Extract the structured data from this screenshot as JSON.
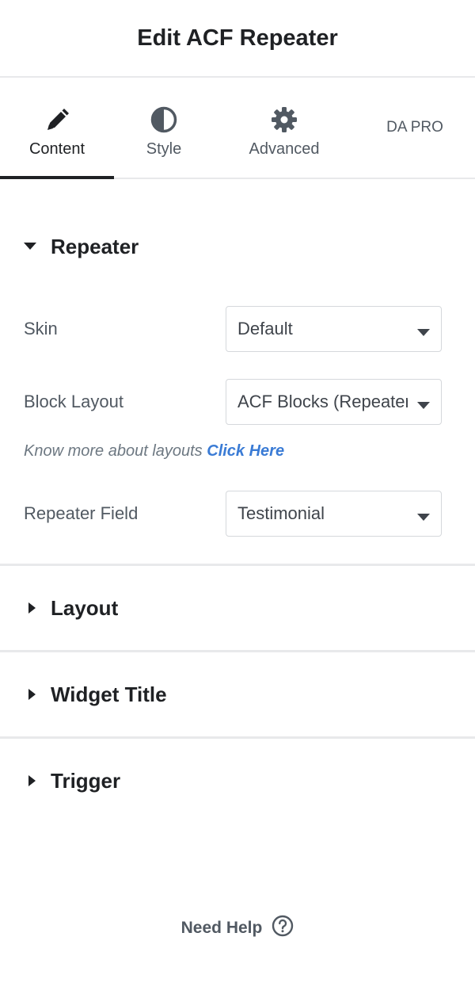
{
  "header": {
    "title": "Edit ACF Repeater"
  },
  "tabs": [
    {
      "label": "Content",
      "icon": "pencil-icon",
      "active": true
    },
    {
      "label": "Style",
      "icon": "contrast-icon",
      "active": false
    },
    {
      "label": "Advanced",
      "icon": "gear-icon",
      "active": false
    },
    {
      "label": "DA PRO",
      "icon": "",
      "active": false
    }
  ],
  "repeater": {
    "title": "Repeater",
    "skin": {
      "label": "Skin",
      "value": "Default"
    },
    "block_layout": {
      "label": "Block Layout",
      "value": "ACF Blocks (Repeater)"
    },
    "note": {
      "text": "Know more about layouts",
      "link": "Click Here"
    },
    "repeater_field": {
      "label": "Repeater Field",
      "value": "Testimonial"
    }
  },
  "sections": {
    "layout": "Layout",
    "widget_title": "Widget Title",
    "trigger": "Trigger"
  },
  "footer": {
    "help_label": "Need Help"
  },
  "colors": {
    "accent_link": "#3a7bd5",
    "text_dark": "#1f2124",
    "text_muted": "#515962"
  }
}
